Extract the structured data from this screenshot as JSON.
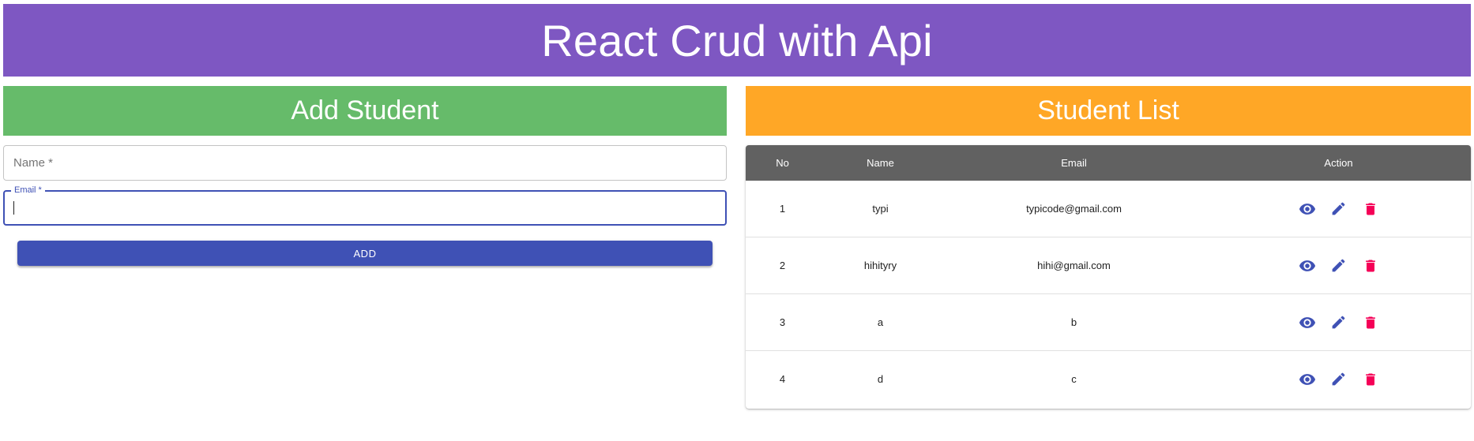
{
  "header": {
    "title": "React Crud with Api"
  },
  "add_panel": {
    "title": "Add Student",
    "name_placeholder": "Name *",
    "email_label": "Email *",
    "email_value": "",
    "add_label": "ADD"
  },
  "list_panel": {
    "title": "Student List",
    "columns": [
      "No",
      "Name",
      "Email",
      "Action"
    ],
    "rows": [
      {
        "no": "1",
        "name": "typi",
        "email": "typicode@gmail.com"
      },
      {
        "no": "2",
        "name": "hihityry",
        "email": "hihi@gmail.com"
      },
      {
        "no": "3",
        "name": "a",
        "email": "b"
      },
      {
        "no": "4",
        "name": "d",
        "email": "c"
      }
    ],
    "action_icons": [
      "eye-icon",
      "pencil-icon",
      "trash-icon"
    ]
  },
  "colors": {
    "header_bg": "#7e57c2",
    "add_panel_bg": "#66bb6a",
    "list_panel_bg": "#ffa726",
    "primary": "#3f51b5",
    "delete": "#f50057",
    "table_head": "#616161"
  }
}
